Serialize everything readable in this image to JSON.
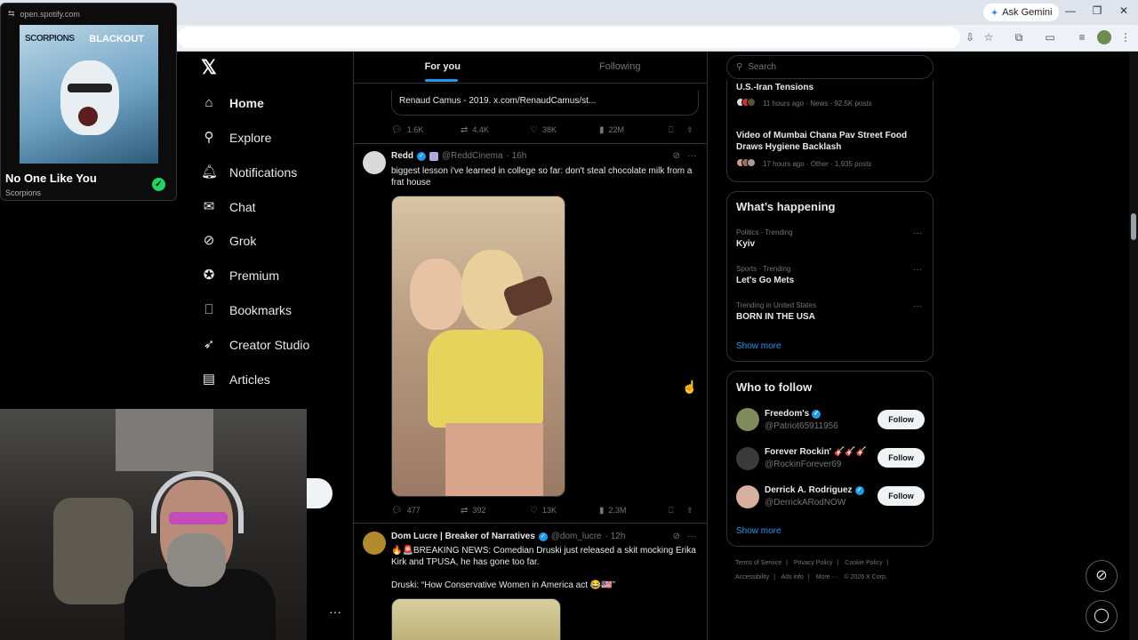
{
  "browser": {
    "gemini_label": "Ask Gemini",
    "window_controls": [
      "—",
      "❐",
      "✕"
    ]
  },
  "spotify": {
    "url": "open.spotify.com",
    "band_logo": "SCORPIONS",
    "album_logo": "BLACKOUT",
    "track_title": "No One Like You",
    "artist": "Scorpions"
  },
  "nav": {
    "items": [
      {
        "label": "Home",
        "icon": "home-icon"
      },
      {
        "label": "Explore",
        "icon": "search-icon"
      },
      {
        "label": "Notifications",
        "icon": "bell-icon"
      },
      {
        "label": "Chat",
        "icon": "mail-icon"
      },
      {
        "label": "Grok",
        "icon": "grok-icon"
      },
      {
        "label": "Premium",
        "icon": "premium-icon"
      },
      {
        "label": "Bookmarks",
        "icon": "bookmark-icon"
      },
      {
        "label": "Creator Studio",
        "icon": "rocket-icon"
      },
      {
        "label": "Articles",
        "icon": "article-icon"
      }
    ]
  },
  "feed": {
    "tabs": [
      "For you",
      "Following"
    ],
    "quoted": {
      "text": "Renaud Camus - 2019. x.com/RenaudCamus/st...",
      "stats": {
        "replies": "1.6K",
        "reposts": "4.4K",
        "likes": "38K",
        "views": "22M"
      }
    },
    "tweet1": {
      "name": "Redd",
      "handle": "@ReddCinema",
      "time": "· 16h",
      "text": "biggest lesson i've learned in college so far: don't steal chocolate milk from a frat house",
      "stats": {
        "replies": "477",
        "reposts": "392",
        "likes": "13K",
        "views": "2.3M"
      }
    },
    "tweet2": {
      "name": "Dom Lucre | Breaker of Narratives",
      "handle": "@dom_lucre",
      "time": "· 12h",
      "text": "🔥🚨BREAKING NEWS: Comedian Druski just released a skit mocking Erika Kirk and TPUSA, he has gone too far.\n\nDruski: “How Conservative Women in America act 😂🇺🇸”"
    }
  },
  "sidebar": {
    "search_placeholder": "Search",
    "top_trends": [
      {
        "title": "U.S.-Iran Tensions",
        "meta": "11 hours ago · News · 92.5K posts"
      },
      {
        "title": "Video of Mumbai Chana Pav Street Food Draws Hygiene Backlash",
        "meta": "17 hours ago · Other · 1,935 posts"
      }
    ],
    "happening": {
      "title": "What’s happening",
      "trends": [
        {
          "category": "Politics · Trending",
          "name": "Kyiv"
        },
        {
          "category": "Sports · Trending",
          "name": "Let's Go Mets"
        },
        {
          "category": "Trending in United States",
          "name": "BORN IN THE USA"
        }
      ],
      "show_more": "Show more"
    },
    "who_to_follow": {
      "title": "Who to follow",
      "accounts": [
        {
          "name": "Freedom's",
          "handle": "@Patriot65911956",
          "verified": true,
          "button": "Follow"
        },
        {
          "name": "Forever Rockin' 🎸🎸🎸",
          "handle": "@RockinForever69",
          "verified": false,
          "button": "Follow"
        },
        {
          "name": "Derrick A. Rodriguez",
          "handle": "@DerrickARodNOW",
          "verified": true,
          "button": "Follow"
        }
      ],
      "show_more": "Show more"
    },
    "footer": [
      "Terms of Service",
      "|",
      "Privacy Policy",
      "|",
      "Cookie Policy",
      "|",
      "Accessibility",
      "|",
      "Ads info",
      "|",
      "More ···",
      "© 2026 X Corp."
    ]
  },
  "colors": {
    "accent": "#1d9bf0",
    "background": "#000000",
    "spotify_green": "#1ed760"
  }
}
